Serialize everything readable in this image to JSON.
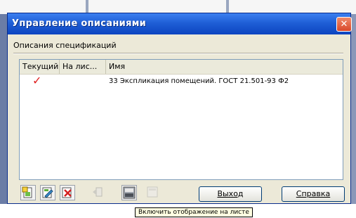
{
  "window": {
    "title": "Управление описаниями",
    "close_glyph": "✕"
  },
  "group_label": "Описания спецификаций",
  "list": {
    "columns": [
      "Текущий",
      "На лис...",
      "Имя"
    ],
    "rows": [
      {
        "current": "✓",
        "on_sheet": "",
        "name": "33 Экспликация помещений. ГОСТ 21.501-93 Ф2"
      }
    ]
  },
  "toolbar": {
    "icons": [
      {
        "name": "add-description-icon",
        "enabled": true
      },
      {
        "name": "edit-description-icon",
        "enabled": true
      },
      {
        "name": "delete-description-icon",
        "enabled": true
      },
      {
        "name": "disabled-action-icon",
        "enabled": false
      },
      {
        "name": "show-on-sheet-icon",
        "enabled": true
      },
      {
        "name": "disabled-display-icon",
        "enabled": false
      }
    ]
  },
  "buttons": {
    "exit_label": "Выход",
    "help_label": "Справка"
  },
  "tooltip": "Включить отображение на листе",
  "colors": {
    "title_bar": "#1f5fd6",
    "check": "#e02020",
    "dialog_bg": "#ece9d8",
    "close_button": "#d9482a"
  }
}
